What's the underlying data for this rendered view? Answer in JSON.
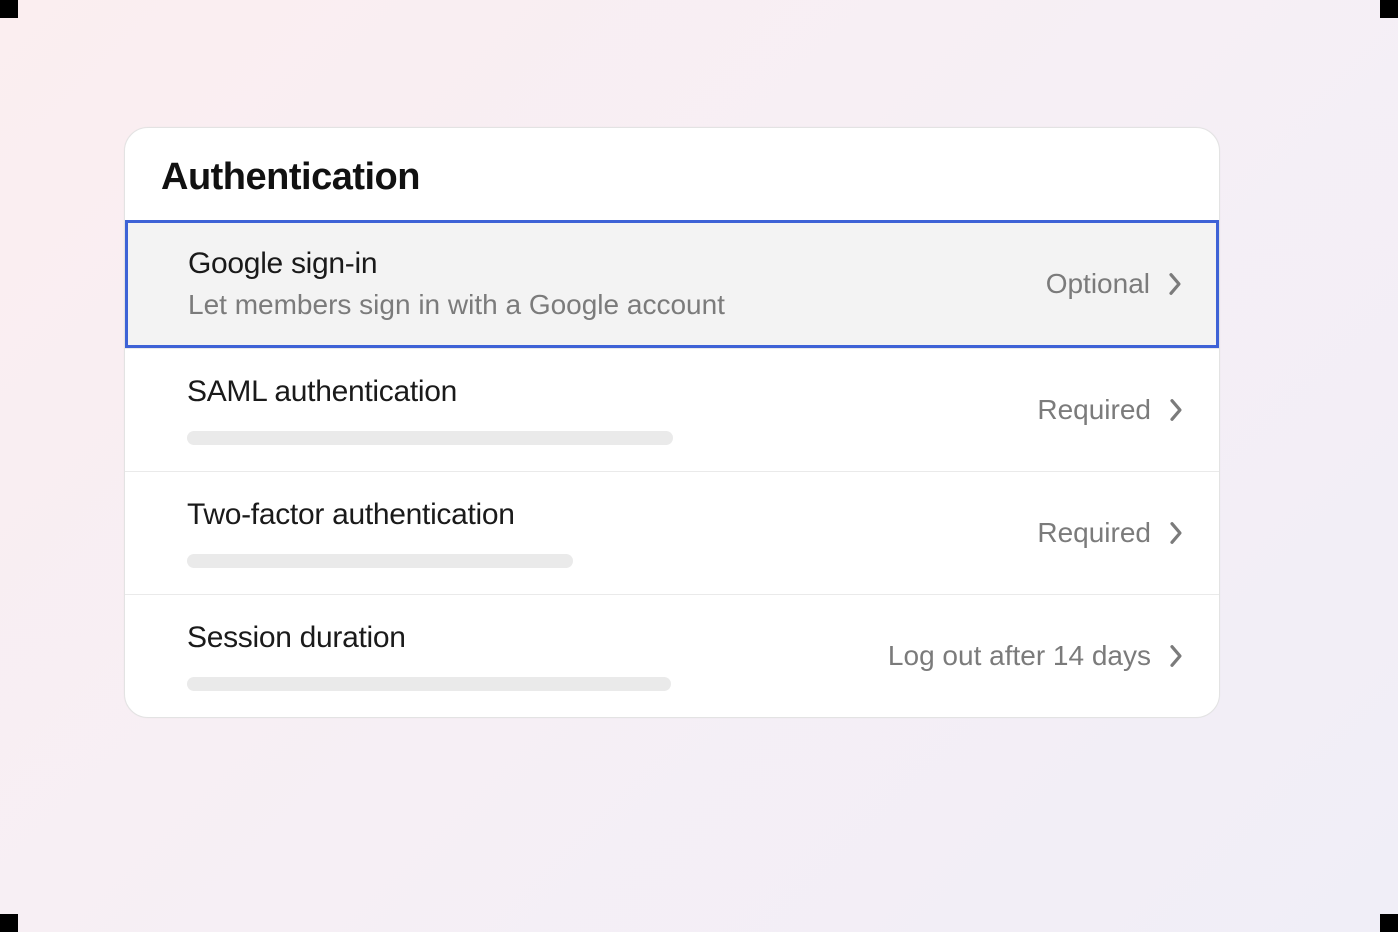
{
  "panel": {
    "title": "Authentication",
    "rows": [
      {
        "title": "Google sign-in",
        "description": "Let members sign in with a Google account",
        "value": "Optional",
        "selected": true,
        "placeholder_width": 0
      },
      {
        "title": "SAML authentication",
        "description": "",
        "value": "Required",
        "selected": false,
        "placeholder_width": 486
      },
      {
        "title": "Two-factor authentication",
        "description": "",
        "value": "Required",
        "selected": false,
        "placeholder_width": 386
      },
      {
        "title": "Session duration",
        "description": "",
        "value": "Log out after 14 days",
        "selected": false,
        "placeholder_width": 484
      }
    ]
  }
}
